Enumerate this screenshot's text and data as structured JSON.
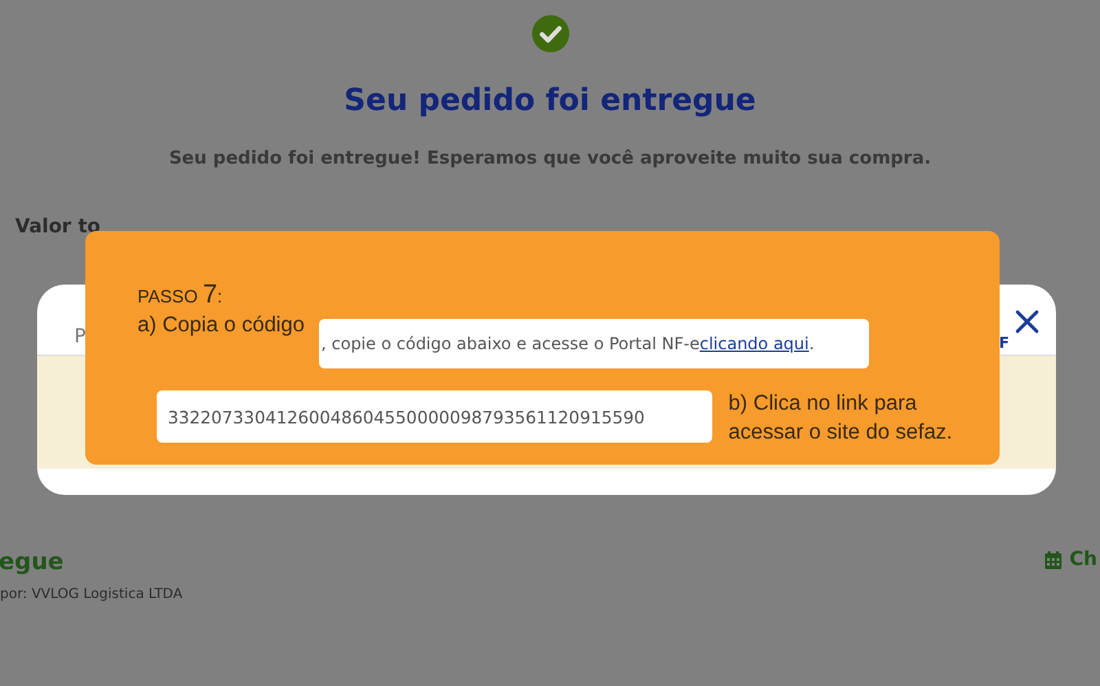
{
  "page": {
    "title": "Seu pedido foi entregue",
    "message": "Seu pedido foi entregue! Esperamos que você aproveite muito sua compra.",
    "summary_label": "Valor to",
    "delivery": {
      "status": "egue",
      "carrier": "por: VVLOG Logistica LTDA",
      "action": "Ch"
    }
  },
  "modal": {
    "label": "P",
    "side_text": "F"
  },
  "tooltip": {
    "step_word": "PASSO",
    "step_number": "7",
    "step_suffix": ":",
    "instruction_a": "a) Copia o código",
    "link_sentence": ", copie o código abaixo e acesse o Portal NF-e",
    "link_label": "clicando aqui",
    "link_end": ".",
    "code": "33220733041260048604550000098793561120915590",
    "instruction_b": "b) Clica no link para acessar o site do sefaz."
  }
}
